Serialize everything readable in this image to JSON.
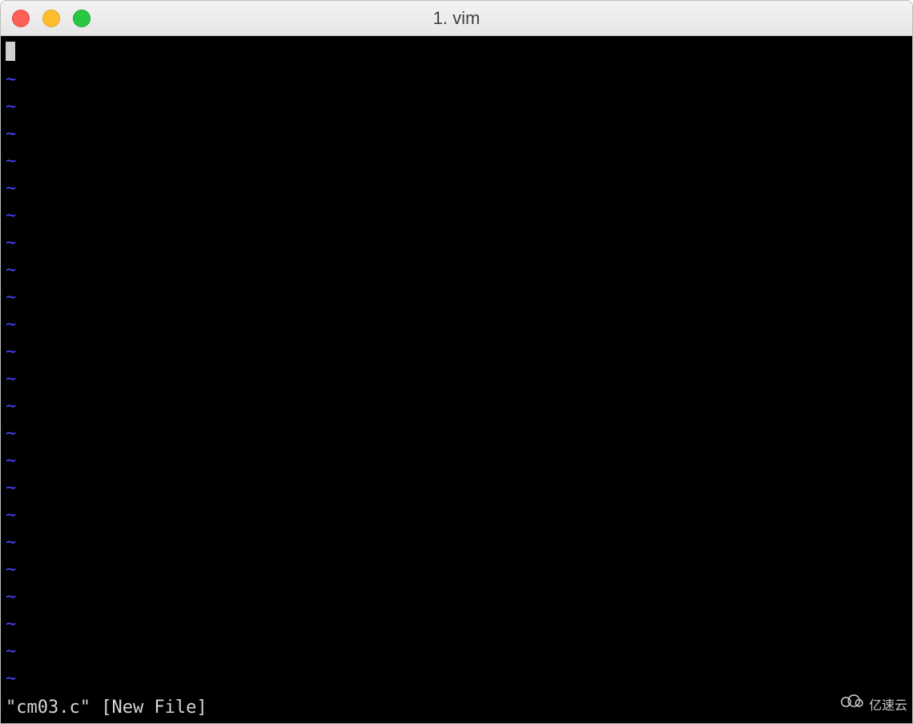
{
  "titlebar": {
    "title": "1. vim",
    "buttons": {
      "close": "close",
      "minimize": "minimize",
      "zoom": "zoom"
    }
  },
  "editor": {
    "cursor_line_content": "",
    "tilde_char": "~",
    "empty_line_count": 23
  },
  "statusline": {
    "text": "\"cm03.c\" [New File]"
  },
  "watermark": {
    "text": "亿速云"
  }
}
